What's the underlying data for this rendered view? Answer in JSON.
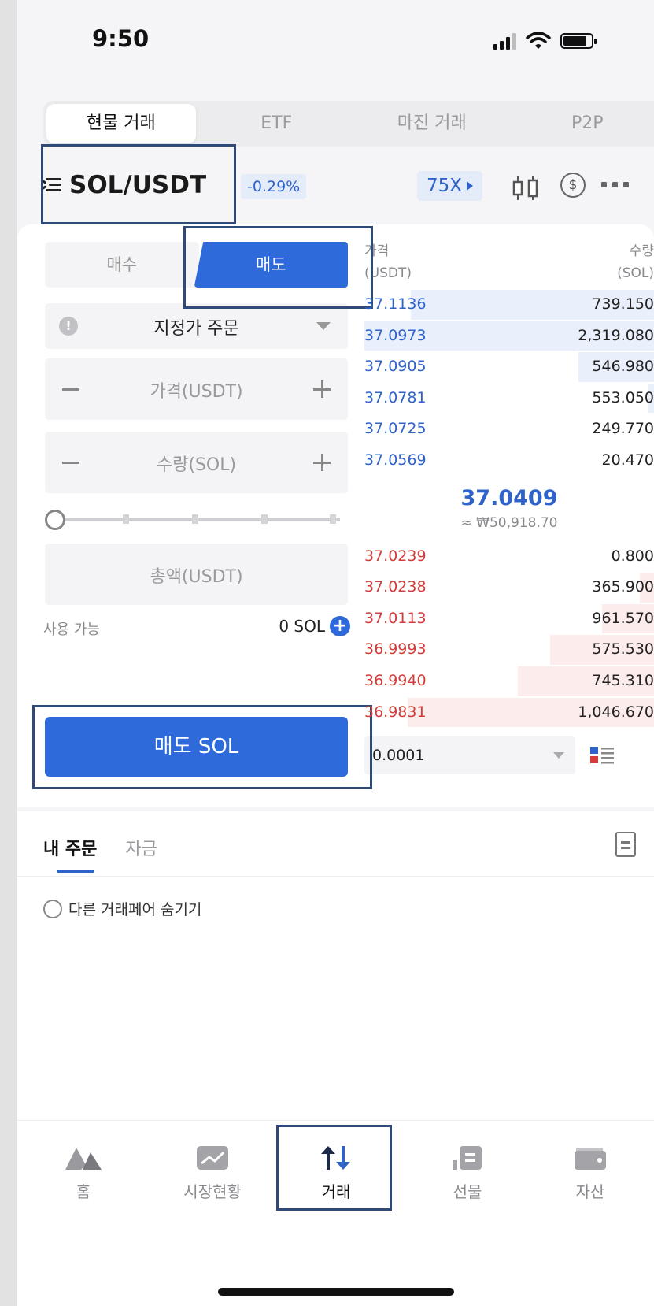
{
  "status_bar": {
    "time": "9:50"
  },
  "top_tabs": [
    {
      "label": "현물 거래",
      "active": true
    },
    {
      "label": "ETF",
      "active": false
    },
    {
      "label": "마진 거래",
      "active": false
    },
    {
      "label": "P2P",
      "active": false
    }
  ],
  "pair": {
    "symbol": "SOL/USDT",
    "change": "-0.29%",
    "leverage": "75X"
  },
  "order_form": {
    "buy_label": "매수",
    "sell_label": "매도",
    "active_side": "sell",
    "order_type": "지정가 주문",
    "price_placeholder": "가격(USDT)",
    "amount_placeholder": "수량(SOL)",
    "total_placeholder": "총액(USDT)",
    "available_label": "사용 가능",
    "available_value": "0 SOL",
    "submit_label": "매도 SOL"
  },
  "order_book": {
    "price_header": "가격",
    "price_unit": "(USDT)",
    "qty_header": "수량",
    "qty_unit": "(SOL)",
    "asks": [
      {
        "price": "37.1136",
        "qty": "739.150",
        "depth": 0.84
      },
      {
        "price": "37.0973",
        "qty": "2,319.080",
        "depth": 1.0
      },
      {
        "price": "37.0905",
        "qty": "546.980",
        "depth": 0.26
      },
      {
        "price": "37.0781",
        "qty": "553.050",
        "depth": 0.02
      },
      {
        "price": "37.0725",
        "qty": "249.770",
        "depth": 0.0
      },
      {
        "price": "37.0569",
        "qty": "20.470",
        "depth": 0.0
      }
    ],
    "mid_price": "37.0409",
    "mid_krw": "≈ ₩50,918.70",
    "bids": [
      {
        "price": "37.0239",
        "qty": "0.800",
        "depth": 0.0
      },
      {
        "price": "37.0238",
        "qty": "365.900",
        "depth": 0.05
      },
      {
        "price": "37.0113",
        "qty": "961.570",
        "depth": 0.18
      },
      {
        "price": "36.9993",
        "qty": "575.530",
        "depth": 0.36
      },
      {
        "price": "36.9940",
        "qty": "745.310",
        "depth": 0.47
      },
      {
        "price": "36.9831",
        "qty": "1,046.670",
        "depth": 0.85
      }
    ],
    "precision": "0.0001"
  },
  "orders": {
    "tabs": [
      {
        "label": "내 주문",
        "active": true
      },
      {
        "label": "자금",
        "active": false
      }
    ],
    "hide_pairs_label": "다른 거래페어 숨기기"
  },
  "bottom_nav": [
    {
      "label": "홈",
      "icon": "home-icon",
      "active": false
    },
    {
      "label": "시장현황",
      "icon": "market-chart-icon",
      "active": false
    },
    {
      "label": "거래",
      "icon": "trade-arrows-icon",
      "active": true
    },
    {
      "label": "선물",
      "icon": "futures-icon",
      "active": false
    },
    {
      "label": "자산",
      "icon": "wallet-icon",
      "active": false
    }
  ],
  "colors": {
    "accent_blue": "#2f6adb",
    "ask_blue": "#2f63c9",
    "bid_red": "#d43c3c",
    "highlight_box": "#2f4a78"
  }
}
